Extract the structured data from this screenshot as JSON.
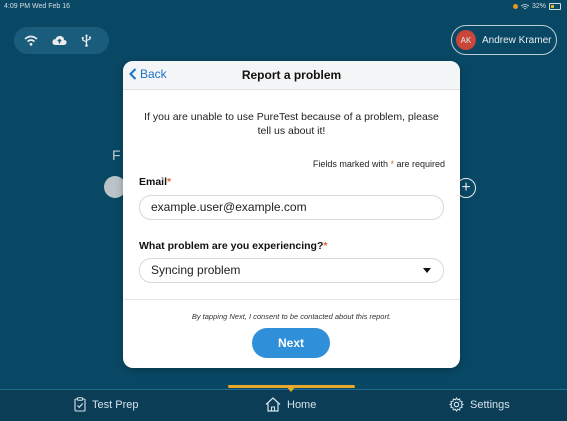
{
  "status_bar": {
    "time": "4:09 PM  Wed Feb 16",
    "battery": "32%"
  },
  "top_bar": {
    "icons": [
      "wifi-icon",
      "cloud-upload-icon",
      "usb-icon"
    ],
    "user": {
      "initials": "AK",
      "name": "Andrew Kramer"
    }
  },
  "modal": {
    "back_label": "Back",
    "title": "Report a problem",
    "intro": "If you are unable to use PureTest because of a problem, please tell us about it!",
    "required_note_prefix": "Fields marked with ",
    "required_star": "*",
    "required_note_suffix": " are required",
    "email": {
      "label": "Email",
      "value": "example.user@example.com"
    },
    "problem": {
      "label": "What problem are you experiencing?",
      "selected": "Syncing problem"
    },
    "consent": "By tapping Next, I consent to be contacted about this report.",
    "next_label": "Next"
  },
  "tabs": [
    {
      "label": "Test Prep",
      "icon": "clipboard-check-icon"
    },
    {
      "label": "Home",
      "icon": "home-icon",
      "active": true
    },
    {
      "label": "Settings",
      "icon": "gear-icon"
    }
  ],
  "colors": {
    "background": "#0a4f6e",
    "accent": "#2f8fd8",
    "active_indicator": "#e8a82a",
    "required": "#e0663a"
  }
}
